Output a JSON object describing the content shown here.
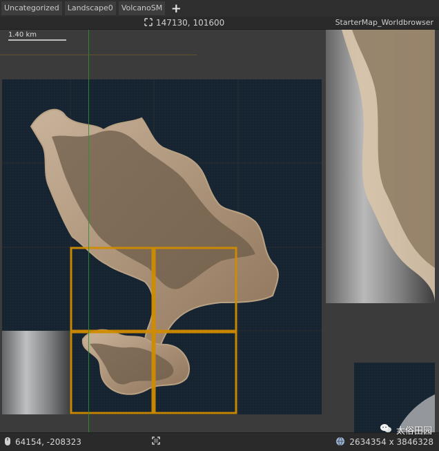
{
  "tabs": [
    {
      "label": "Uncategorized"
    },
    {
      "label": "Landscape0"
    },
    {
      "label": "VolcanoSM"
    }
  ],
  "add_tab_label": "+",
  "top": {
    "coords": "147130, 101600",
    "map_title": "StarterMap_Worldbrowser"
  },
  "scale": {
    "label": "1.40 km"
  },
  "bottom": {
    "mouse_coords": "64154, -208323",
    "world_size": "2634354 x 3846328"
  },
  "watermark": {
    "text": "太俗田园"
  },
  "colors": {
    "selection": "#d18c00",
    "water": "#182634",
    "terrain": "#8b775f"
  }
}
